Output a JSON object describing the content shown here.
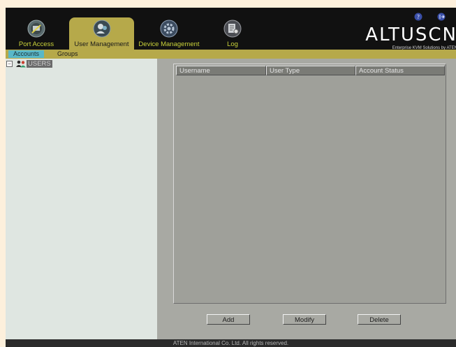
{
  "header": {
    "nav_tabs": [
      {
        "label": "Port Access",
        "icon": "port-access-icon"
      },
      {
        "label": "User Management",
        "icon": "user-management-icon"
      },
      {
        "label": "Device Management",
        "icon": "device-management-icon"
      },
      {
        "label": "Log",
        "icon": "log-icon"
      }
    ],
    "active_tab": "User Management",
    "brand_name": "ALTUSCN",
    "brand_tagline": "Enterprise KVM Solutions by ATEN",
    "icons": [
      "help-icon",
      "logout-icon"
    ]
  },
  "subtabs": {
    "items": [
      {
        "label": "Accounts"
      },
      {
        "label": "Groups"
      }
    ],
    "active": "Accounts"
  },
  "tree": {
    "root_label": "USERS",
    "toggle": "−",
    "icon": "users-group-icon"
  },
  "table": {
    "columns": [
      "Username",
      "User Type",
      "Account Status"
    ],
    "rows": []
  },
  "actions": {
    "add_label": "Add",
    "modify_label": "Modify",
    "delete_label": "Delete"
  },
  "footer": {
    "text": "ATEN International Co. Ltd. All rights reserved."
  },
  "colors": {
    "header_bg": "#111111",
    "accent_olive": "#b6a94a",
    "accent_yellow": "#c9d23a",
    "active_subtab": "#59b8c9",
    "panel_bg": "#a8a9a3",
    "tree_bg": "#dfe6e1"
  }
}
